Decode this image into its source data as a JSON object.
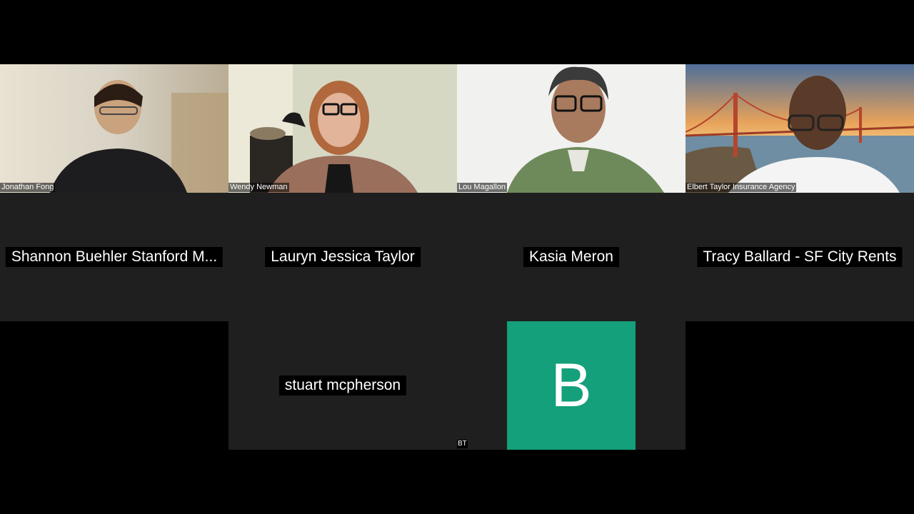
{
  "video_participants": [
    {
      "name": "Jonathan Fong"
    },
    {
      "name": "Wendy Newman"
    },
    {
      "name": "Lou Magallon"
    },
    {
      "name": "Elbert Taylor Insurance Agency"
    }
  ],
  "nocam_participants": [
    {
      "name": "Shannon Buehler Stanford M..."
    },
    {
      "name": "Lauryn Jessica Taylor"
    },
    {
      "name": "Kasia Meron"
    },
    {
      "name": "Tracy Ballard - SF City Rents"
    },
    {
      "name": "stuart mcpherson"
    }
  ],
  "avatar_participant": {
    "initial": "B",
    "initials_tag": "BT",
    "color": "#14a07a"
  },
  "colors": {
    "background": "#000000",
    "tile": "#1f1f1f"
  }
}
